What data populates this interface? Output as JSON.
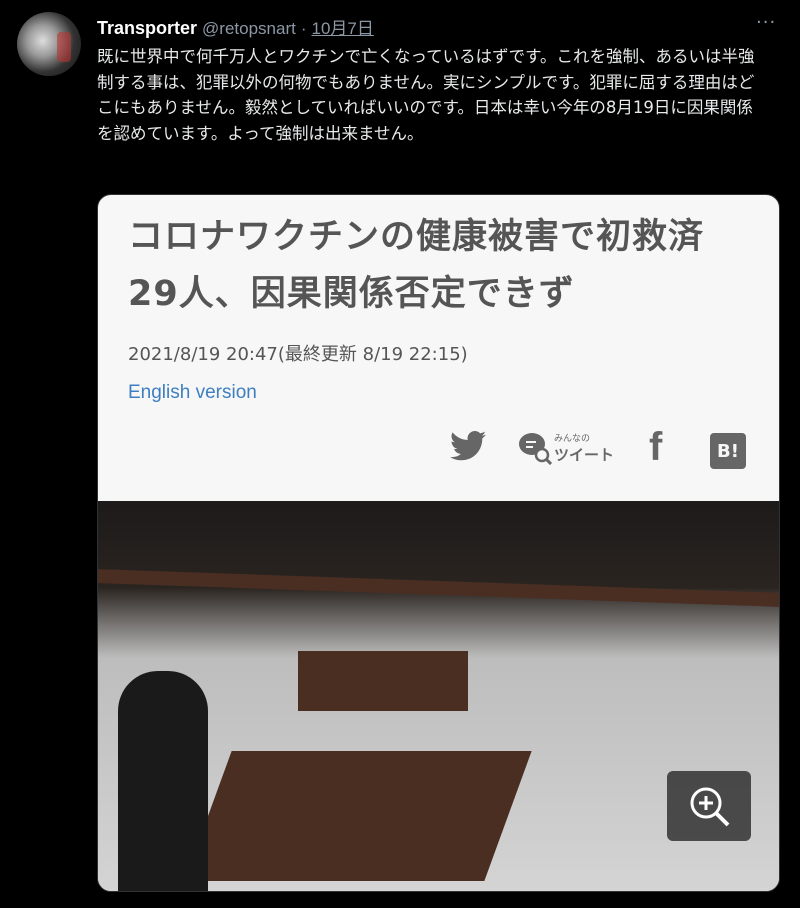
{
  "tweet": {
    "display_name": "Transporter",
    "handle": "@retopsnart",
    "separator": "·",
    "date": "10月7日",
    "more_label": "···",
    "text": "既に世界中で何千万人とワクチンで亡くなっているはずです。これを強制、あるいは半強制する事は、犯罪以外の何物でもありません。実にシンプルです。犯罪に屈する理由はどこにもありません。毅然としていればいいのです。日本は幸い今年の8月19日に因果関係を認めています。よって強制は出来ません。"
  },
  "card": {
    "headline": "コロナワクチンの健康被害で初救済　29人、因果関係否定できず",
    "timestamp": "2021/8/19 20:47(最終更新 8/19 22:15)",
    "english_link": "English version",
    "share": {
      "minna_small": "みんなの",
      "minna_big": "ツイート",
      "hatena": "B!"
    },
    "zoom_icon": "zoom-in-icon"
  },
  "colors": {
    "background": "#000000",
    "link": "#3d7fc1",
    "muted": "#8b98a5"
  }
}
